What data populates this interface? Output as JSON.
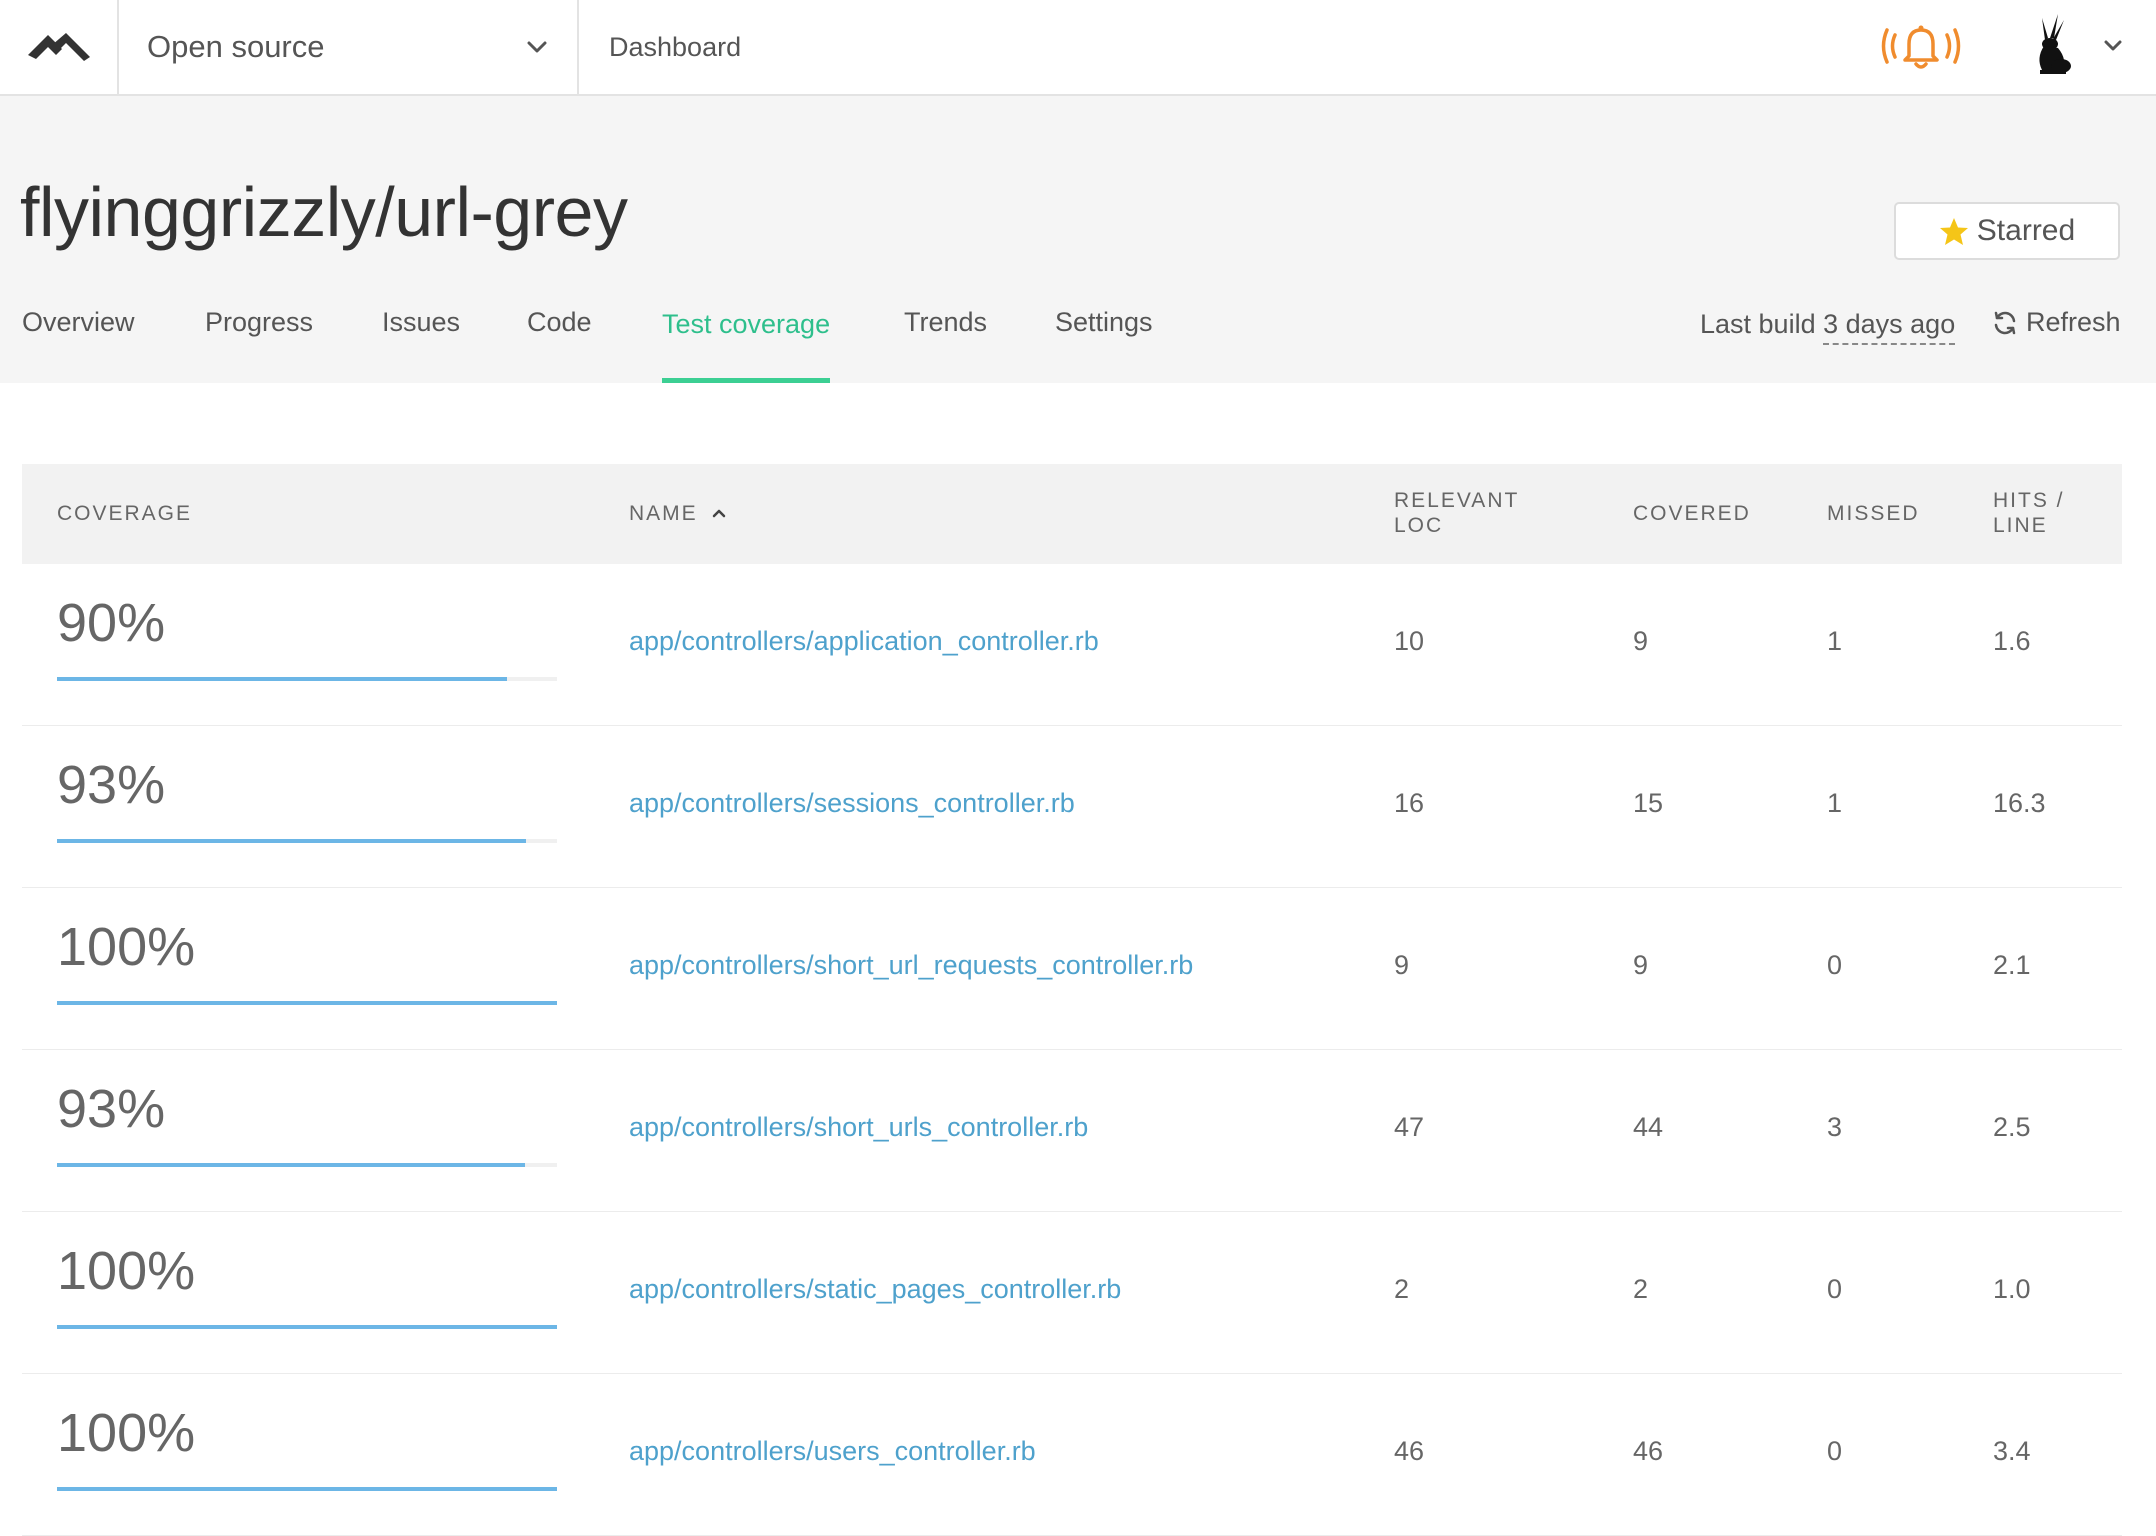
{
  "topbar": {
    "logo_icon": "codeclimate-logo-icon",
    "org_name": "Open source",
    "dashboard_label": "Dashboard",
    "notification_icon": "bell-ringing-icon",
    "notification_color": "#f08c2e",
    "avatar_icon": "rabbit-avatar-icon"
  },
  "repo": {
    "title": "flyinggrizzly/url-grey",
    "star_label": "Starred",
    "star_color": "#f5c518"
  },
  "tabs": [
    {
      "label": "Overview",
      "active": false
    },
    {
      "label": "Progress",
      "active": false
    },
    {
      "label": "Issues",
      "active": false
    },
    {
      "label": "Code",
      "active": false
    },
    {
      "label": "Test coverage",
      "active": true
    },
    {
      "label": "Trends",
      "active": false
    },
    {
      "label": "Settings",
      "active": false
    }
  ],
  "build": {
    "prefix": "Last build",
    "ago": "3 days ago",
    "refresh_label": "Refresh"
  },
  "table": {
    "headers": {
      "coverage": "COVERAGE",
      "name": "NAME",
      "relevant_loc_1": "RELEVANT",
      "relevant_loc_2": "LOC",
      "covered": "COVERED",
      "missed": "MISSED",
      "hits_1": "HITS /",
      "hits_2": "LINE"
    },
    "rows": [
      {
        "coverage": "90%",
        "coverage_fraction": 0.9,
        "name": "app/controllers/application_controller.rb",
        "relevant": "10",
        "covered": "9",
        "missed": "1",
        "hits": "1.6"
      },
      {
        "coverage": "93%",
        "coverage_fraction": 0.9375,
        "name": "app/controllers/sessions_controller.rb",
        "relevant": "16",
        "covered": "15",
        "missed": "1",
        "hits": "16.3"
      },
      {
        "coverage": "100%",
        "coverage_fraction": 1.0,
        "name": "app/controllers/short_url_requests_controller.rb",
        "relevant": "9",
        "covered": "9",
        "missed": "0",
        "hits": "2.1"
      },
      {
        "coverage": "93%",
        "coverage_fraction": 0.936,
        "name": "app/controllers/short_urls_controller.rb",
        "relevant": "47",
        "covered": "44",
        "missed": "3",
        "hits": "2.5"
      },
      {
        "coverage": "100%",
        "coverage_fraction": 1.0,
        "name": "app/controllers/static_pages_controller.rb",
        "relevant": "2",
        "covered": "2",
        "missed": "0",
        "hits": "1.0"
      },
      {
        "coverage": "100%",
        "coverage_fraction": 1.0,
        "name": "app/controllers/users_controller.rb",
        "relevant": "46",
        "covered": "46",
        "missed": "0",
        "hits": "3.4"
      }
    ]
  },
  "colors": {
    "accent": "#3ccf93",
    "link": "#4ea1cc",
    "bar": "#6cb6e6"
  }
}
